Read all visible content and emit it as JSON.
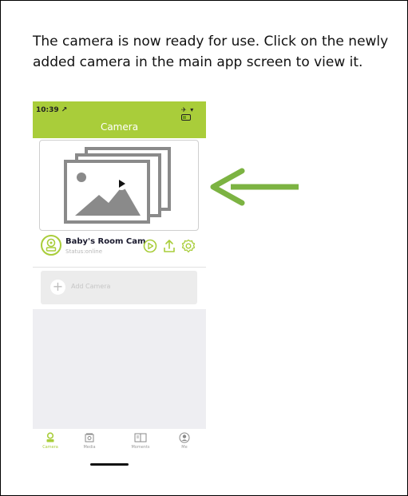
{
  "instruction": "The camera is now ready for use. Click on the newly added camera in the main app screen to view it.",
  "phone": {
    "status_time": "10:39 ↗",
    "status_icons": "✈ ▾",
    "header_title": "Camera",
    "camera": {
      "name": "Baby's Room Cam",
      "status": "Status:online"
    },
    "add_camera_label": "Add Camera",
    "add_camera_icon": "+",
    "tabs": [
      {
        "label": "Camera",
        "icon": "camera-person-icon",
        "active": true
      },
      {
        "label": "Media",
        "icon": "media-icon",
        "active": false
      },
      {
        "label": "Moments",
        "icon": "moments-book-icon",
        "active": false
      },
      {
        "label": "Me",
        "icon": "profile-icon",
        "active": false
      }
    ]
  },
  "colors": {
    "accent_green": "#a9cd3a",
    "arrow_green": "#7cb342",
    "text_dark": "#111111",
    "icon_gray": "#8a8a8a"
  }
}
